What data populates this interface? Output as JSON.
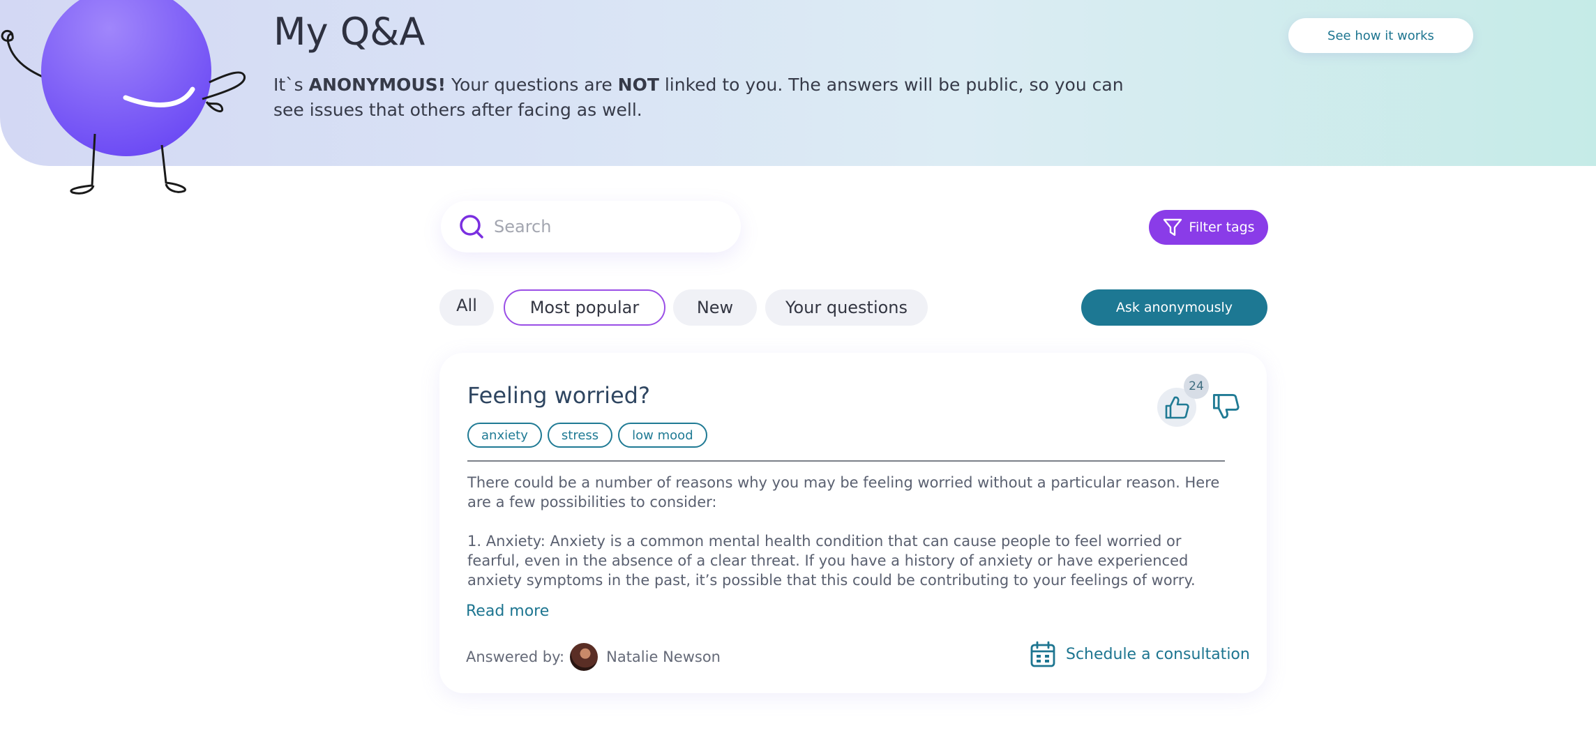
{
  "header": {
    "title": "My Q&A",
    "intro": {
      "part1": "It`s ",
      "bold1": "ANONYMOUS!",
      "part2": " Your questions are ",
      "bold2": "NOT",
      "part3": " linked to you. The answers will be public, so you can see issues that others after facing as well."
    },
    "how_button": "See how it works"
  },
  "search": {
    "placeholder": "Search",
    "value": ""
  },
  "filter_button": "Filter tags",
  "tabs": [
    {
      "label": "All",
      "active": false
    },
    {
      "label": "Most popular",
      "active": true
    },
    {
      "label": "New",
      "active": false
    },
    {
      "label": "Your questions",
      "active": false
    }
  ],
  "ask_button": "Ask anonymously",
  "question": {
    "title": "Feeling worried?",
    "tags": [
      "anxiety",
      "stress",
      "low mood"
    ],
    "likes": "24",
    "answer_paragraphs": [
      "There could be a number of reasons why you may be feeling worried without a particular reason. Here are a few possibilities to consider:",
      "1. Anxiety: Anxiety is a common mental health condition that can cause people to feel worried or fearful, even in the absence of a clear threat. If you have a history of anxiety or have experienced anxiety symptoms in the past, it’s possible that this could be contributing to your feelings of worry."
    ],
    "read_more": "Read more",
    "answered_by_label": "Answered by:",
    "answerer_name": "Natalie Newson",
    "consult_link": "Schedule a consultation"
  },
  "colors": {
    "accent_purple": "#8a3ce8",
    "accent_teal": "#1d7893",
    "mascot": "#7050f5"
  }
}
